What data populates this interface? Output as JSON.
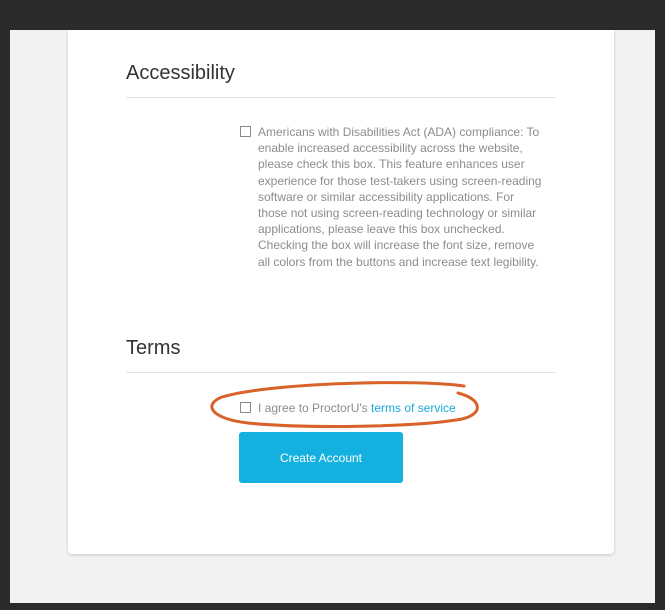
{
  "accessibility": {
    "heading": "Accessibility",
    "ada_lines": [
      "Americans with Disabilities Act (ADA) compliance: To",
      "enable increased accessibility across the website,",
      "please check this box. This feature enhances user",
      "experience for those test-takers using screen-reading",
      "software or similar accessibility applications. For",
      "those not using screen-reading technology or similar",
      "applications, please leave this box unchecked.",
      "Checking the box will increase the font size, remove",
      "all colors from the buttons and increase text legibility."
    ],
    "ada_checked": false
  },
  "terms": {
    "heading": "Terms",
    "agree_prefix": "I agree to ProctorU's",
    "link_text": "terms of service",
    "agree_checked": false
  },
  "actions": {
    "create_account_label": "Create Account"
  },
  "colors": {
    "primary_button": "#14b1e0",
    "link": "#1ba9d9",
    "annotation": "#d9622b"
  }
}
